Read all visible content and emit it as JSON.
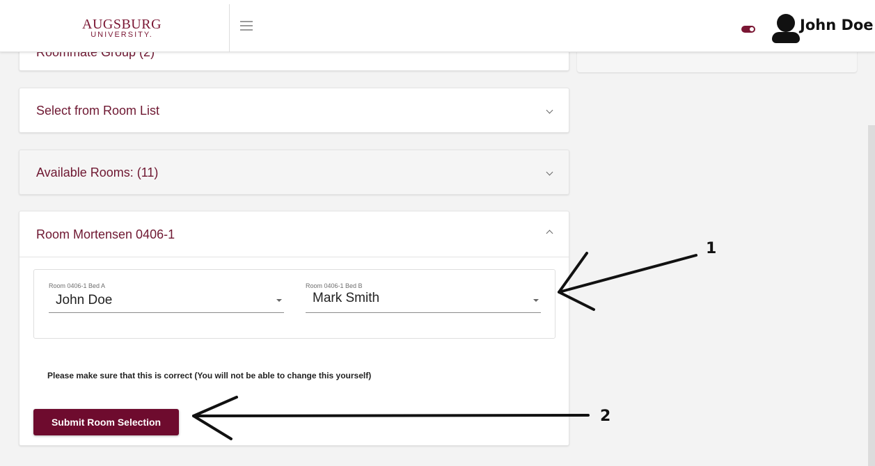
{
  "header": {
    "logo_main": "AUGSBURG",
    "logo_sub": "UNIVERSITY.",
    "menu_icon": "hamburger-icon",
    "toggle_icon": "toggle-icon",
    "avatar_icon": "user-avatar-icon",
    "user_name": "John Doe"
  },
  "accordions": [
    {
      "title": "Roommate Group (2)",
      "state": "collapsed"
    },
    {
      "title": "Select from Room List",
      "state": "collapsed"
    },
    {
      "title": "Available Rooms: (11)",
      "state": "collapsed"
    },
    {
      "title": "Room Mortensen 0406-1",
      "state": "expanded"
    }
  ],
  "room": {
    "bed_a": {
      "label": "Room 0406-1 Bed A",
      "value": "John Doe"
    },
    "bed_b": {
      "label": "Room 0406-1 Bed B",
      "value": "Mark Smith"
    },
    "notice": "Please make sure that this is correct (You will not be able to change this yourself)",
    "submit_label": "Submit Room Selection"
  },
  "annotations": [
    {
      "number": "1",
      "points_to": "bed selection fields"
    },
    {
      "number": "2",
      "points_to": "submit room selection button"
    }
  ],
  "colors": {
    "brand": "#6e1731",
    "button": "#6e0b2e",
    "background": "#f3f3f3"
  }
}
